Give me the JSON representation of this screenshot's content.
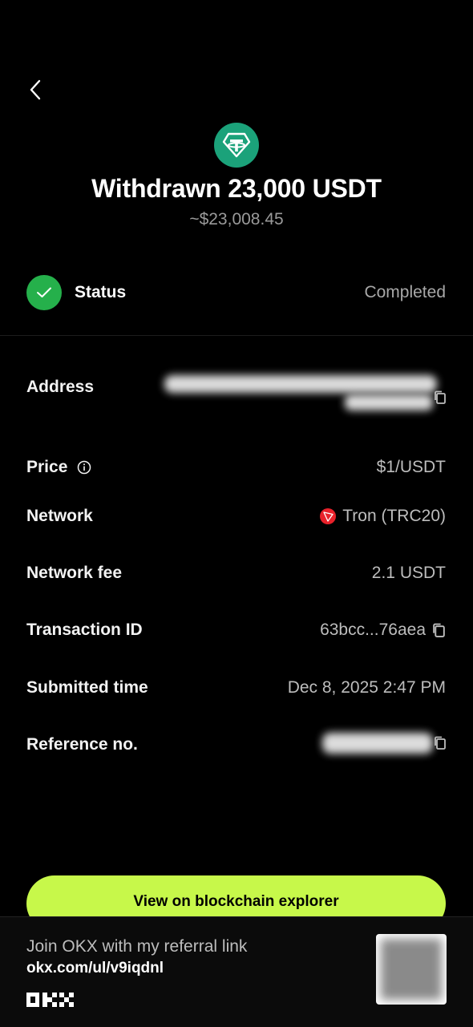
{
  "header": {
    "title": "Withdrawn 23,000 USDT",
    "usd_equivalent": "~$23,008.45",
    "coin_icon": "tether-icon"
  },
  "status": {
    "label": "Status",
    "value": "Completed",
    "color": "#25b04b"
  },
  "details": {
    "address": {
      "label": "Address"
    },
    "price": {
      "label": "Price",
      "value": "$1/USDT"
    },
    "network": {
      "label": "Network",
      "value": "Tron (TRC20)"
    },
    "network_fee": {
      "label": "Network fee",
      "value": "2.1 USDT"
    },
    "transaction_id": {
      "label": "Transaction ID",
      "value": "63bcc...76aea"
    },
    "submitted_time": {
      "label": "Submitted time",
      "value": "Dec 8, 2025 2:47 PM"
    },
    "reference_no": {
      "label": "Reference no."
    }
  },
  "actions": {
    "explorer_label": "View on blockchain explorer",
    "accent": "#c7f84a"
  },
  "footer": {
    "referral_text": "Join OKX with my referral link",
    "referral_link": "okx.com/ul/v9iqdnl",
    "logo_text": "OKX"
  }
}
